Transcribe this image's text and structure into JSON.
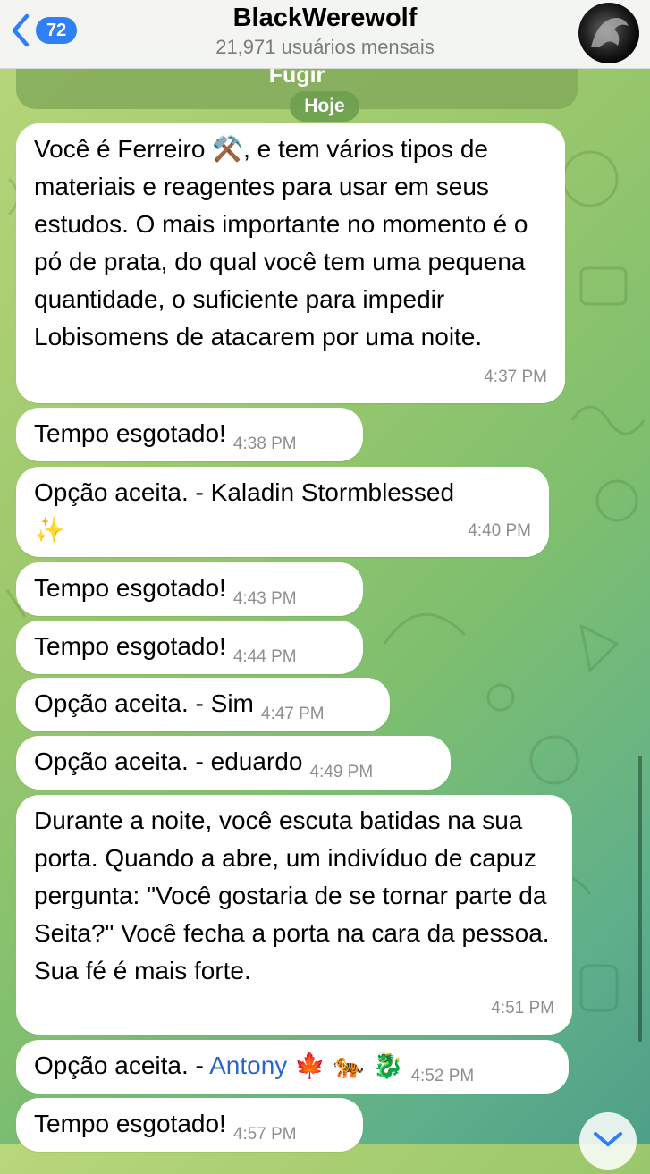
{
  "header": {
    "back_count": "72",
    "title": "BlackWerewolf",
    "subtitle": "21,971 usuários mensais"
  },
  "previous_message_fragment": "Fugir",
  "date_separator": "Hoje",
  "messages": [
    {
      "text": "Você é Ferreiro ⚒️, e tem vários tipos de materiais e reagentes para usar em seus estudos. O mais importante no momento é o pó de prata, do qual você tem uma pequena quantidade, o suficiente para impedir Lobisomens de atacarem por uma noite.",
      "time": "4:37 PM"
    },
    {
      "text": "Tempo esgotado!",
      "time": "4:38 PM"
    },
    {
      "text": "Opção aceita. - Kaladin Stormblessed",
      "emoji": "✨",
      "time": "4:40 PM"
    },
    {
      "text": "Tempo esgotado!",
      "time": "4:43 PM"
    },
    {
      "text": "Tempo esgotado!",
      "time": "4:44 PM"
    },
    {
      "text": "Opção aceita. - Sim",
      "time": "4:47 PM"
    },
    {
      "text": "Opção aceita. - eduardo",
      "time": "4:49 PM"
    },
    {
      "text": "Durante a noite, você escuta batidas na sua porta. Quando a abre, um indivíduo de capuz pergunta: \"Você gostaria de se tornar parte da Seita?\" Você fecha a porta na cara da pessoa. Sua fé é mais forte.",
      "time": "4:51 PM"
    },
    {
      "prefix": "Opção aceita. - ",
      "link": "Antony",
      "emoji": "🍁 🐅 🐉",
      "time": "4:52 PM"
    },
    {
      "text": "Tempo esgotado!",
      "time": "4:57 PM"
    }
  ],
  "colors": {
    "accent": "#2f7ff7",
    "link": "#2c66c6",
    "bubble": "#ffffff",
    "timestamp": "#8f8f8f"
  }
}
